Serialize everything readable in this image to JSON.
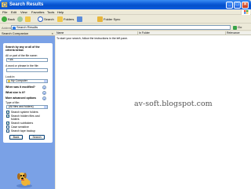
{
  "window": {
    "title": "Search Results",
    "controls": [
      "_",
      "□",
      "×"
    ]
  },
  "menu": [
    "File",
    "Edit",
    "View",
    "Favorites",
    "Tools",
    "Help"
  ],
  "toolbar": {
    "back": "Back",
    "search": "Search",
    "folders": "Folders",
    "folder_sync": "Folder Sync"
  },
  "address": {
    "label": "Address",
    "value": "Search Results",
    "go": "Go"
  },
  "search_pane": {
    "header": "Search Companion",
    "close": "×",
    "intro": [
      "Search by any or all of the",
      "criteria below."
    ],
    "name_label": "All or part of the file name:",
    "name_value": "*.sis",
    "phrase_label": "A word or phrase in the file:",
    "phrase_value": "",
    "lookin_label": "Look in:",
    "lookin_value": "My Computer",
    "modified": "When was it modified?",
    "size": "What size is it?",
    "advanced": "More advanced options",
    "type_label": "Type of file:",
    "type_value": "(All files and folders)",
    "options": [
      {
        "label": "Search system folders",
        "checked": true
      },
      {
        "label": "Search hidden files and",
        "label2": "folders",
        "checked": true
      },
      {
        "label": "Search subfolders",
        "checked": true
      },
      {
        "label": "Case sensitive",
        "checked": false
      },
      {
        "label": "Search tape backup",
        "checked": false
      }
    ],
    "back_button": "Back",
    "search_button": "Search"
  },
  "results": {
    "columns": [
      "Name",
      "In Folder",
      "Relevance"
    ],
    "message": "To start your search, follow the instructions in the left pane.",
    "watermark": "av-soft.blogspot.com"
  }
}
